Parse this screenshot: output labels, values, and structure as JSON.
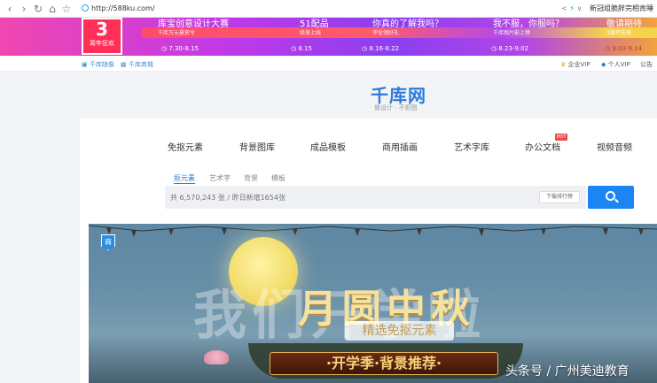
{
  "browser": {
    "back_icon": "back-arrow-icon",
    "forward_icon": "forward-arrow-icon",
    "url": "http://588ku.com/",
    "right_text": "新冠组脆胖完相肯睡"
  },
  "banner": {
    "anniv_big": "3",
    "anniv_small": "周年狂欢",
    "promos": [
      {
        "title": "库宝创意设计大赛",
        "sub": "千库万元悬赏令",
        "date": "7.30-8.15"
      },
      {
        "title": "51配品",
        "sub": "修身上线",
        "date": "8.15"
      },
      {
        "title": "你真的了解我吗？",
        "sub": "评论领好礼",
        "date": "8.16-8.22"
      },
      {
        "title": "我不服，你服吗？",
        "sub": "千库图片影上榜",
        "date": "8.23-9.02"
      },
      {
        "title": "敬请期待",
        "sub": "3周年庆典",
        "date": "9.03-9.14"
      }
    ]
  },
  "subhead": {
    "left1": "千库随像",
    "left2": "千库商城",
    "vip_enterprise": "企业VIP",
    "vip_personal": "个人VIP",
    "notice": "公告"
  },
  "logo": {
    "text": "千库网",
    "tagline": "做设计 · 不抠图"
  },
  "categories": [
    "免抠元素",
    "背景图库",
    "成品模板",
    "商用插画",
    "艺术字库",
    "办公文档",
    "视频音频"
  ],
  "hot_badge": "HOT",
  "search": {
    "tabs": [
      "抠元素",
      "艺术字",
      "背景",
      "模板"
    ],
    "placeholder": "共 6,570,243 张 / 昨日新增1654张",
    "rank_button": "下载排行榜"
  },
  "hero": {
    "badge": "商",
    "title": "我们开学啦",
    "title_front": "月圆中秋",
    "sub": "精选免抠元素",
    "sub2": "·开学季·背景推荐·",
    "watermark": "头条号 / 广州美迪教育"
  }
}
